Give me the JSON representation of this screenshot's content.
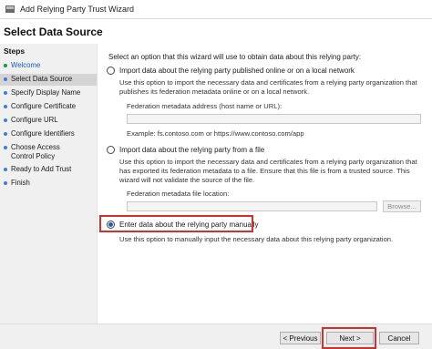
{
  "window": {
    "title": "Add Relying Party Trust Wizard"
  },
  "page_title": "Select Data Source",
  "sidebar": {
    "title": "Steps",
    "items": [
      {
        "label": "Welcome"
      },
      {
        "label": "Select Data Source"
      },
      {
        "label": "Specify Display Name"
      },
      {
        "label": "Configure Certificate"
      },
      {
        "label": "Configure URL"
      },
      {
        "label": "Configure Identifiers"
      },
      {
        "label": "Choose Access Control Policy"
      },
      {
        "label": "Ready to Add Trust"
      },
      {
        "label": "Finish"
      }
    ]
  },
  "main": {
    "intro": "Select an option that this wizard will use to obtain data about this relying party:",
    "option_online": {
      "label": "Import data about the relying party published online or on a local network",
      "description": "Use this option to import the necessary data and certificates from a relying party organization that publishes its federation metadata online or on a local network.",
      "field_label": "Federation metadata address (host name or URL):",
      "field_value": "",
      "example": "Example: fs.contoso.com or https://www.contoso.com/app",
      "selected": false
    },
    "option_file": {
      "label": "Import data about the relying party from a file",
      "description": "Use this option to import the necessary data and certificates from a relying party organization that has exported its federation metadata to a file. Ensure that this file is from a trusted source.  This wizard will not validate the source of the file.",
      "field_label": "Federation metadata file location:",
      "field_value": "",
      "browse_label": "Browse...",
      "selected": false
    },
    "option_manual": {
      "label": "Enter data about the relying party manually",
      "description": "Use this option to manually input the necessary data about this relying party organization.",
      "selected": true
    }
  },
  "footer": {
    "previous": "< Previous",
    "next": "Next >",
    "cancel": "Cancel"
  },
  "colors": {
    "highlight": "#d32f2f",
    "accent": "#1a5fb4"
  }
}
